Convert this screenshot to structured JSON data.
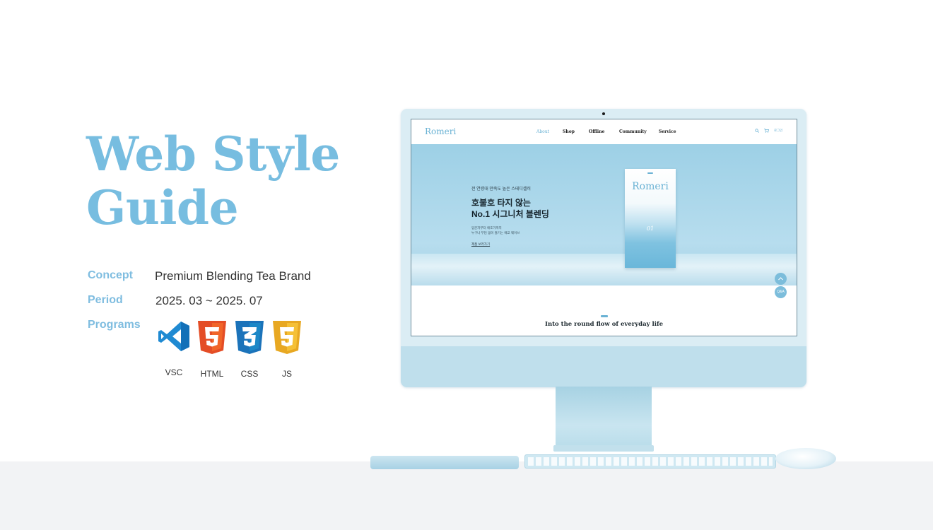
{
  "title": {
    "line1": "Web Style",
    "line2": "Guide"
  },
  "info": {
    "concept_label": "Concept",
    "concept_value": "Premium Blending Tea Brand",
    "period_label": "Period",
    "period_value": "2025. 03 ~ 2025. 07",
    "programs_label": "Programs"
  },
  "programs": [
    {
      "name": "VSC",
      "icon": "vscode-icon",
      "color": "#1f8ad2"
    },
    {
      "name": "HTML",
      "icon": "html5-icon",
      "color": "#e44d26"
    },
    {
      "name": "CSS",
      "icon": "css3-icon",
      "color": "#1b73ba"
    },
    {
      "name": "JS",
      "icon": "js-icon",
      "color": "#f0b429"
    }
  ],
  "site": {
    "logo": "Romeri",
    "nav": [
      "About",
      "Shop",
      "Offline",
      "Community",
      "Service"
    ],
    "nav_icons": [
      "search-icon",
      "cart-icon",
      "login-icon"
    ],
    "login": "로그인",
    "hero_sub": "전 연령대 만족도 높은 스테디셀러",
    "hero_line1": "호불호 타지 않는",
    "hero_line2": "No.1 시그니처 블렌딩",
    "hero_small1": "입문자부터 애호가까지",
    "hero_small2": "누구나 부담 없이 즐기는 애교 웨이브",
    "hero_link": "제품 보러가기",
    "box_brand": "Romeri",
    "box_number": "01",
    "qa_label": "Q&A",
    "tagline": "Into the round flow of everyday life"
  },
  "colors": {
    "accent": "#77bde0",
    "text": "#333333",
    "floor": "#f2f3f5"
  }
}
